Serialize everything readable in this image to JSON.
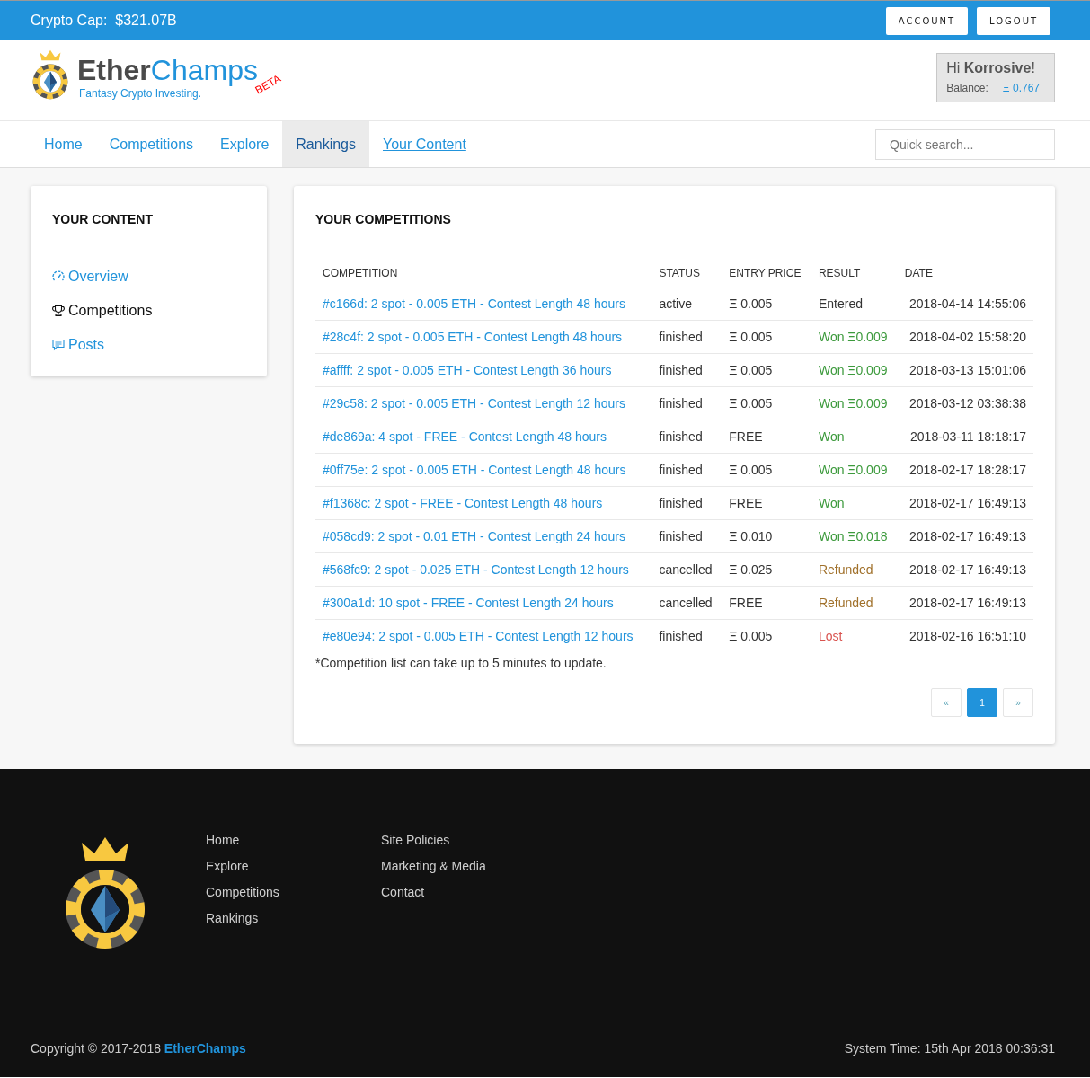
{
  "top_bar": {
    "label": "Crypto Cap:",
    "value": "$321.07B",
    "buttons": [
      "ACCOUNT",
      "LOGOUT"
    ]
  },
  "brand": {
    "name_dark": "Ether",
    "name_light": "Champs",
    "badge": "BETA",
    "tagline": "Fantasy Crypto Investing."
  },
  "user_box": {
    "greeting": "Hi",
    "username": "Korrosive",
    "exclaim": "!",
    "balance_label": "Balance:",
    "balance_value": "Ξ 0.767"
  },
  "nav": {
    "items": [
      {
        "label": "Home",
        "selected": false,
        "focused": false
      },
      {
        "label": "Competitions",
        "selected": false,
        "focused": false
      },
      {
        "label": "Explore",
        "selected": false,
        "focused": false
      },
      {
        "label": "Rankings",
        "selected": true,
        "focused": false
      },
      {
        "label": "Your Content",
        "selected": false,
        "focused": true
      }
    ],
    "search": {
      "placeholder": "Quick search..."
    }
  },
  "sidebar": {
    "title": "YOUR CONTENT",
    "items": [
      {
        "label": "Overview",
        "kind": "gauge",
        "selected": false
      },
      {
        "label": "Competitions",
        "kind": "trophy",
        "selected": true
      },
      {
        "label": "Posts",
        "kind": "comment",
        "selected": false
      }
    ]
  },
  "competitions": {
    "title": "YOUR COMPETITIONS",
    "columns": [
      "COMPETITION",
      "STATUS",
      "ENTRY PRICE",
      "RESULT",
      "DATE"
    ],
    "rows": [
      {
        "competition": "#c166d: 2 spot - 0.005 ETH - Contest Length 48 hours",
        "status": "active",
        "entry_price": "Ξ 0.005",
        "result": "Entered",
        "kind": "entered",
        "date": "2018-04-14 14:55:06"
      },
      {
        "competition": "#28c4f: 2 spot - 0.005 ETH - Contest Length 48 hours",
        "status": "finished",
        "entry_price": "Ξ 0.005",
        "result": "Won Ξ0.009",
        "kind": "won",
        "date": "2018-04-02 15:58:20"
      },
      {
        "competition": "#affff: 2 spot - 0.005 ETH - Contest Length 36 hours",
        "status": "finished",
        "entry_price": "Ξ 0.005",
        "result": "Won Ξ0.009",
        "kind": "won",
        "date": "2018-03-13 15:01:06"
      },
      {
        "competition": "#29c58: 2 spot - 0.005 ETH - Contest Length 12 hours",
        "status": "finished",
        "entry_price": "Ξ 0.005",
        "result": "Won Ξ0.009",
        "kind": "won",
        "date": "2018-03-12 03:38:38"
      },
      {
        "competition": "#de869a: 4 spot - FREE - Contest Length 48 hours",
        "status": "finished",
        "entry_price": "FREE",
        "result": "Won",
        "kind": "won",
        "date": "2018-03-11 18:18:17"
      },
      {
        "competition": "#0ff75e: 2 spot - 0.005 ETH - Contest Length 48 hours",
        "status": "finished",
        "entry_price": "Ξ 0.005",
        "result": "Won Ξ0.009",
        "kind": "won",
        "date": "2018-02-17 18:28:17"
      },
      {
        "competition": "#f1368c: 2 spot - FREE - Contest Length 48 hours",
        "status": "finished",
        "entry_price": "FREE",
        "result": "Won",
        "kind": "won",
        "date": "2018-02-17 16:49:13"
      },
      {
        "competition": "#058cd9: 2 spot - 0.01 ETH - Contest Length 24 hours",
        "status": "finished",
        "entry_price": "Ξ 0.010",
        "result": "Won Ξ0.018",
        "kind": "won",
        "date": "2018-02-17 16:49:13"
      },
      {
        "competition": "#568fc9: 2 spot - 0.025 ETH - Contest Length 12 hours",
        "status": "cancelled",
        "entry_price": "Ξ 0.025",
        "result": "Refunded",
        "kind": "refunded",
        "date": "2018-02-17 16:49:13"
      },
      {
        "competition": "#300a1d: 10 spot - FREE - Contest Length 24 hours",
        "status": "cancelled",
        "entry_price": "FREE",
        "result": "Refunded",
        "kind": "refunded",
        "date": "2018-02-17 16:49:13"
      },
      {
        "competition": "#e80e94: 2 spot - 0.005 ETH - Contest Length 12 hours",
        "status": "finished",
        "entry_price": "Ξ 0.005",
        "result": "Lost",
        "kind": "lost",
        "date": "2018-02-16 16:51:10"
      }
    ],
    "note": "*Competition list can take up to 5 minutes to update.",
    "pagination": [
      {
        "label": "«",
        "selected": false
      },
      {
        "label": "1",
        "selected": true
      },
      {
        "label": "»",
        "selected": false
      }
    ]
  },
  "footer": {
    "columns": [
      [
        "Home",
        "Explore",
        "Competitions",
        "Rankings"
      ],
      [
        "Site Policies",
        "Marketing & Media",
        "Contact"
      ]
    ],
    "copyright": "Copyright © 2017-2018",
    "copyright_brand": "EtherChamps",
    "system_time": "System Time: 15th Apr 2018 00:36:31"
  }
}
